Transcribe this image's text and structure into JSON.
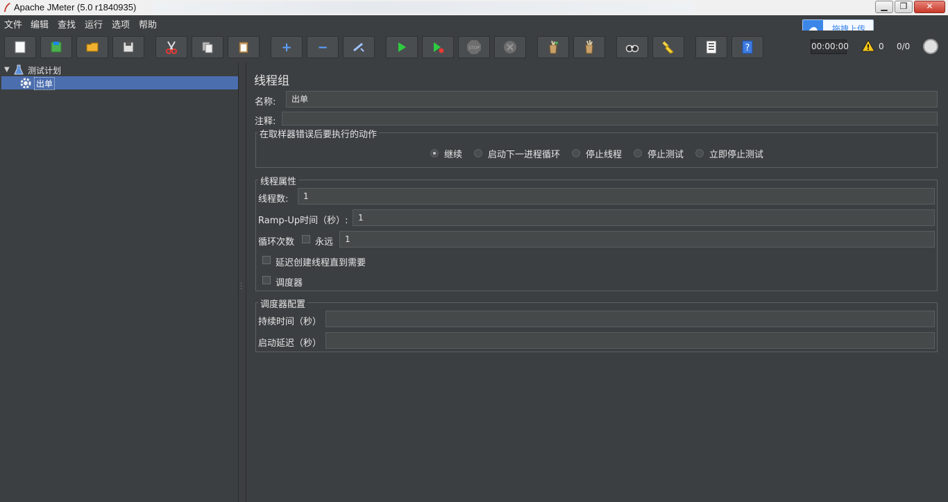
{
  "window": {
    "title": "Apache JMeter (5.0 r1840935)"
  },
  "menu": [
    "文件",
    "编辑",
    "查找",
    "运行",
    "选项",
    "帮助"
  ],
  "toolbar": {
    "icons": [
      "new-icon",
      "templates-icon",
      "open-icon",
      "save-icon",
      "cut-icon",
      "copy-icon",
      "paste-icon",
      "expand-icon",
      "collapse-icon",
      "toggle-icon",
      "start-icon",
      "start-no-pause-icon",
      "stop-icon",
      "shutdown-icon",
      "clear-icon",
      "clear-all-icon",
      "search-icon",
      "reset-search-icon",
      "function-helper-icon",
      "help-icon"
    ],
    "stop_label": "STOP",
    "timer": "00:00:00",
    "warning_count": "0",
    "thread_count": "0/0"
  },
  "baidu": {
    "label": "拖拽上传"
  },
  "tree": {
    "test_plan": "测试计划",
    "selected": "出单"
  },
  "panel": {
    "title": "线程组",
    "name_label": "名称:",
    "name_value": "出单",
    "comment_label": "注释:",
    "comment_value": "",
    "error_action": {
      "title": "在取样器错误后要执行的动作",
      "options": [
        "继续",
        "启动下一进程循环",
        "停止线程",
        "停止测试",
        "立即停止测试"
      ],
      "selected": "继续"
    },
    "thread_props": {
      "title": "线程属性",
      "threads_label": "线程数:",
      "threads_value": "1",
      "rampup_label": "Ramp-Up时间（秒）:",
      "rampup_value": "1",
      "loop_label": "循环次数",
      "forever_label": "永远",
      "loop_value": "1",
      "delay_label": "延迟创建线程直到需要",
      "scheduler_label": "调度器"
    },
    "scheduler": {
      "title": "调度器配置",
      "duration_label": "持续时间（秒）",
      "duration_value": "",
      "delay_label": "启动延迟（秒）",
      "delay_value": ""
    }
  }
}
